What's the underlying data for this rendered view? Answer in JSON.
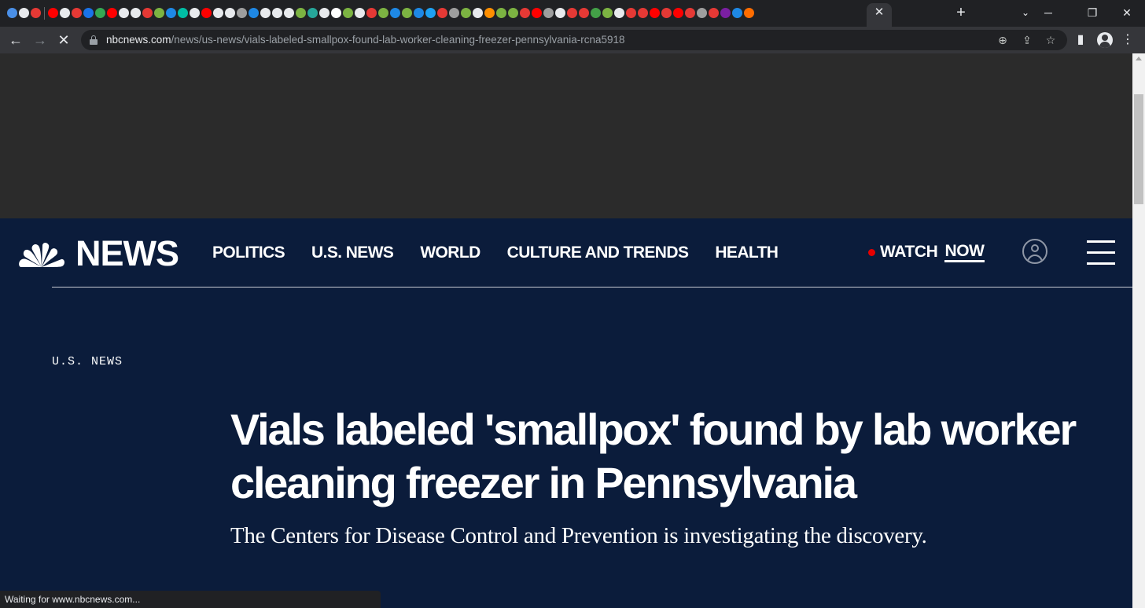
{
  "browser": {
    "tab_icon_colors": [
      "#4a8fe7",
      "#e8eaed",
      "#e53935",
      "#ff0000",
      "#e8eaed",
      "#e53935",
      "#1a73e8",
      "#34a853",
      "#ff0000",
      "#e8eaed",
      "#e8eaed",
      "#e53935",
      "#7cb342",
      "#1e88e5",
      "#00bfa5",
      "#e8eaed",
      "#ff0000",
      "#e8eaed",
      "#e8eaed",
      "#9e9e9e",
      "#1e88e5",
      "#e8eaed",
      "#e8eaed",
      "#e8eaed",
      "#7cb342",
      "#26a69a",
      "#e8eaed",
      "#ffffff",
      "#7cb342",
      "#e8eaed",
      "#e53935",
      "#7cb342",
      "#1e88e5",
      "#7cb342",
      "#1e88e5",
      "#1da1f2",
      "#e53935",
      "#9e9e9e",
      "#7cb342",
      "#e8eaed",
      "#ff8f00",
      "#7cb342",
      "#7cb342",
      "#e53935",
      "#ff0000",
      "#9e9e9e",
      "#e8eaed",
      "#e53935",
      "#e53935",
      "#43a047",
      "#7cb342",
      "#e8eaed",
      "#e53935",
      "#e53935",
      "#ff0000",
      "#e53935",
      "#ff0000",
      "#e53935",
      "#9e9e9e",
      "#e53935",
      "#7b1fa2",
      "#1e88e5",
      "#ff6d00"
    ],
    "active_tab_close": "✕",
    "new_tab": "+",
    "tab_search": "⌄",
    "window_controls": {
      "minimize": "─",
      "restore": "❐",
      "close": "✕"
    },
    "nav": {
      "back": "←",
      "forward": "→",
      "reload_stop": "✕"
    },
    "url_host": "nbcnews.com",
    "url_path": "/news/us-news/vials-labeled-smallpox-found-lab-worker-cleaning-freezer-pennsylvania-rcna5918",
    "omnibox_icons": {
      "zoom": "⊕",
      "share": "⇪",
      "bookmark": "☆"
    },
    "toolbar_icons": {
      "side_panel": "▮",
      "menu": "⋮"
    },
    "status_text": "Waiting for www.nbcnews.com..."
  },
  "site": {
    "logo_text": "NEWS",
    "nav_items": [
      "POLITICS",
      "U.S. NEWS",
      "WORLD",
      "CULTURE AND TRENDS",
      "HEALTH"
    ],
    "watch_label": "WATCH",
    "watch_now_label": "NOW"
  },
  "article": {
    "section": "U.S. NEWS",
    "headline": "Vials labeled 'smallpox' found by lab worker cleaning freezer in Pennsylvania",
    "dek": "The Centers for Disease Control and Prevention is investigating the discovery."
  },
  "colors": {
    "page_background": "#0b1c3b",
    "ad_background": "#2b2b2b",
    "live_dot": "#e60000"
  }
}
